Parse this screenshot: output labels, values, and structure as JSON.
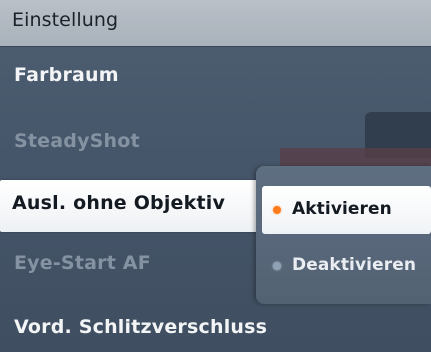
{
  "header": {
    "title": "Einstellung"
  },
  "menu": {
    "items": [
      {
        "label": "Farbraum",
        "state": "enabled"
      },
      {
        "label": "SteadyShot",
        "state": "disabled"
      },
      {
        "label": "Ausl. ohne Objektiv",
        "state": "selected"
      },
      {
        "label": "Eye-Start AF",
        "state": "disabled"
      },
      {
        "label": "Vord. Schlitzverschluss",
        "state": "enabled"
      }
    ]
  },
  "submenu": {
    "options": [
      {
        "label": "Aktivieren",
        "selected": true,
        "dot_color": "#ff7a1a"
      },
      {
        "label": "Deaktivieren",
        "selected": false,
        "dot_color": "#8fa2b6"
      }
    ]
  },
  "colors": {
    "header_bg": "#b9c0c8",
    "screen_bg": "#49586a",
    "highlight": "#ffffff",
    "disabled_text": "#8492a2",
    "accent": "#ff7a1a"
  }
}
